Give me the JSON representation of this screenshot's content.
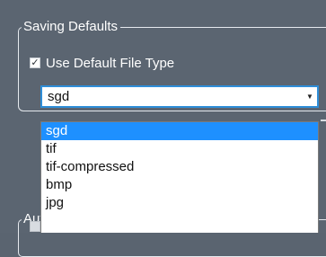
{
  "saving_defaults": {
    "title": "Saving Defaults",
    "use_default_checkbox": {
      "checked": true,
      "label": "Use Default File Type"
    },
    "file_type_combo": {
      "value": "sgd",
      "arrow_icon": "chevron-down-icon"
    },
    "dropdown_options": [
      "sgd",
      "tif",
      "tif-compressed",
      "bmp",
      "jpg"
    ],
    "selected_option": "sgd"
  },
  "auto_group": {
    "title_partial": "Aut"
  },
  "colors": {
    "panel_bg": "#5b6571",
    "selection_blue": "#1e90ff",
    "focus_border": "#2f8ed8"
  }
}
